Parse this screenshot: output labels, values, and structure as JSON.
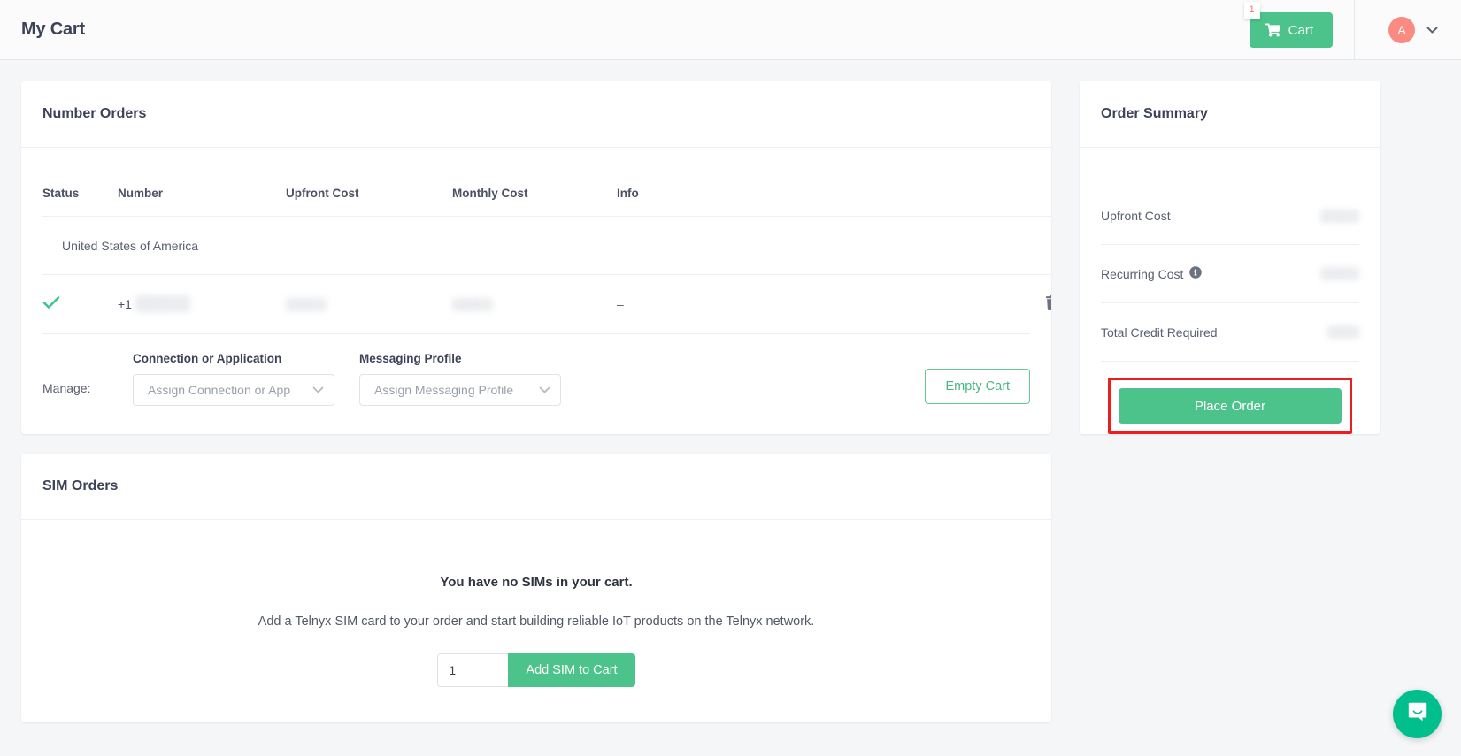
{
  "header": {
    "title": "My Cart",
    "cart_button_label": "Cart",
    "cart_badge_count": "1",
    "avatar_initial": "A"
  },
  "number_orders": {
    "card_title": "Number Orders",
    "columns": {
      "status": "Status",
      "number": "Number",
      "upfront_cost": "Upfront Cost",
      "monthly_cost": "Monthly Cost",
      "info": "Info"
    },
    "country_row": "United States of America",
    "rows": [
      {
        "status": "selected",
        "number_prefix": "+1",
        "number_value": "",
        "upfront_cost": "",
        "monthly_cost": "",
        "info": "–"
      }
    ],
    "manage": {
      "label": "Manage:",
      "connection_label": "Connection or Application",
      "connection_value": "Assign Connection or App",
      "messaging_label": "Messaging Profile",
      "messaging_value": "Assign Messaging Profile",
      "empty_cart_label": "Empty Cart"
    }
  },
  "sim_orders": {
    "card_title": "SIM Orders",
    "empty_heading": "You have no SIMs in your cart.",
    "empty_subtext": "Add a Telnyx SIM card to your order and start building reliable IoT products on the Telnyx network.",
    "quantity_value": "1",
    "add_button_label": "Add SIM to Cart"
  },
  "order_summary": {
    "card_title": "Order Summary",
    "rows": [
      {
        "label": "Upfront Cost",
        "value": "",
        "has_help": false
      },
      {
        "label": "Recurring Cost",
        "value": "",
        "has_help": true
      },
      {
        "label": "Total Credit Required",
        "value": "",
        "has_help": false
      }
    ],
    "place_order_label": "Place Order"
  },
  "colors": {
    "accent_green": "#4cc38a",
    "highlight_red": "#ee1d1d",
    "avatar_pink": "#fa8a82",
    "chat_green": "#00bf8c",
    "page_bg": "#f4f6f8"
  }
}
